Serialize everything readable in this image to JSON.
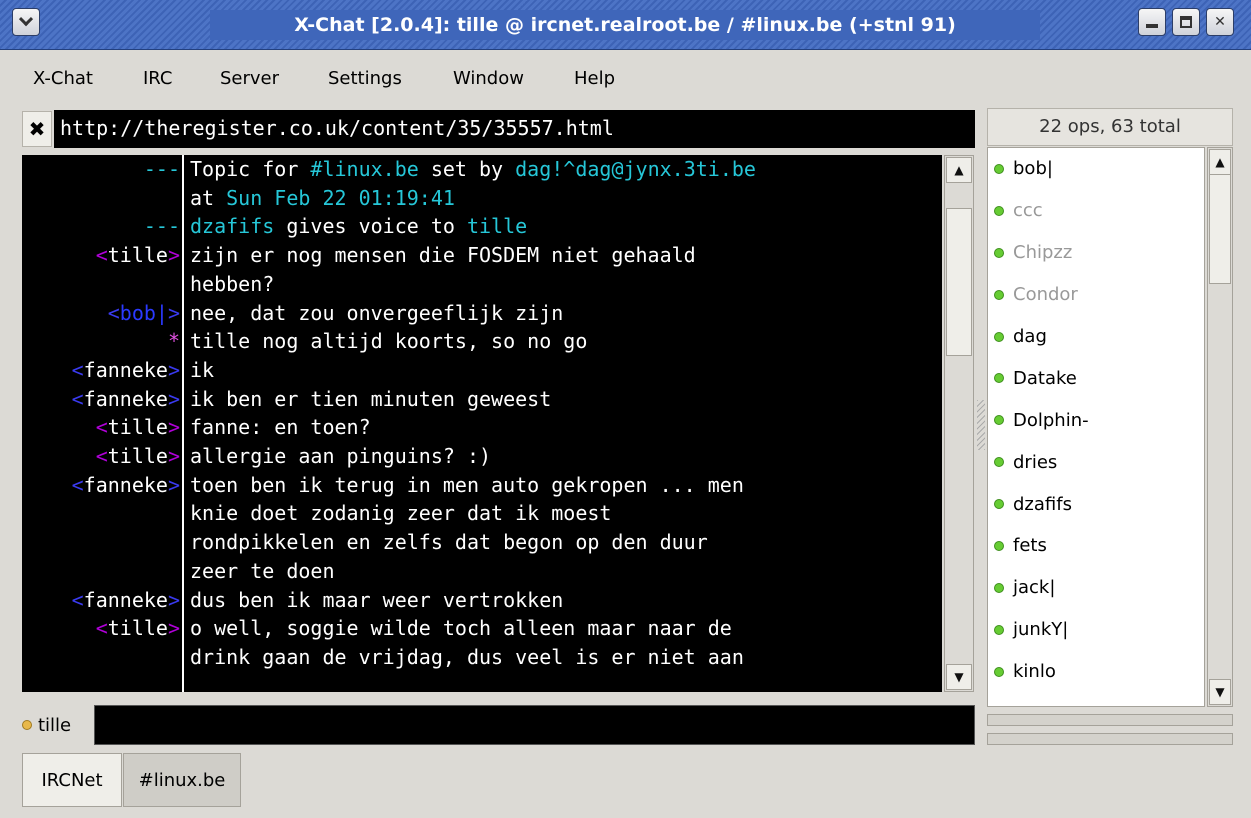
{
  "window": {
    "title": "X-Chat [2.0.4]: tille @ ircnet.realroot.be / #linux.be (+stnl 91)",
    "icons": [
      "window-menu-icon",
      "minimize-icon",
      "maximize-icon",
      "close-icon"
    ]
  },
  "menu": [
    "X-Chat",
    "IRC",
    "Server",
    "Settings",
    "Window",
    "Help"
  ],
  "topic": {
    "close_glyph": "✖",
    "text": "http://theregister.co.uk/content/35/35557.html"
  },
  "user_count": "22 ops, 63 total",
  "chat": [
    {
      "nick": "---",
      "text": "Topic for #linux.be set by dag!^dag@jynx.3ti.be"
    },
    {
      "nick": "",
      "text": "at Sun Feb 22 01:19:41"
    },
    {
      "nick": "---",
      "text": "dzafifs gives voice to tille"
    },
    {
      "nick": "tille",
      "text": "zijn er nog mensen die FOSDEM niet gehaald"
    },
    {
      "nick": "",
      "text": "hebben?"
    },
    {
      "nick": "bob|",
      "text": "nee, dat zou onvergeeflijk zijn"
    },
    {
      "nick": "*",
      "text": "tille nog altijd koorts, so no go"
    },
    {
      "nick": "fanneke",
      "text": "ik"
    },
    {
      "nick": "fanneke",
      "text": "ik ben er tien minuten geweest"
    },
    {
      "nick": "tille",
      "text": "fanne: en toen?"
    },
    {
      "nick": "tille",
      "text": "allergie aan pinguins? :)"
    },
    {
      "nick": "fanneke",
      "text": "toen ben ik terug in men auto gekropen ... men"
    },
    {
      "nick": "",
      "text": "knie doet zodanig zeer dat ik moest"
    },
    {
      "nick": "",
      "text": "rondpikkelen en zelfs dat begon op den duur"
    },
    {
      "nick": "",
      "text": "zeer te doen"
    },
    {
      "nick": "fanneke",
      "text": "dus ben ik maar weer vertrokken"
    },
    {
      "nick": "tille",
      "text": "o well, soggie wilde toch alleen maar naar de"
    },
    {
      "nick": "",
      "text": "drink gaan de vrijdag, dus veel is er niet aan"
    }
  ],
  "users": [
    {
      "name": "bob|",
      "away": false
    },
    {
      "name": "ccc",
      "away": true
    },
    {
      "name": "Chipzz",
      "away": true
    },
    {
      "name": "Condor",
      "away": true
    },
    {
      "name": "dag",
      "away": false
    },
    {
      "name": "Datake",
      "away": false
    },
    {
      "name": "Dolphin-",
      "away": false
    },
    {
      "name": "dries",
      "away": false
    },
    {
      "name": "dzafifs",
      "away": false
    },
    {
      "name": "fets",
      "away": false
    },
    {
      "name": "jack|",
      "away": false
    },
    {
      "name": "junkY|",
      "away": false
    },
    {
      "name": "kinlo",
      "away": false
    }
  ],
  "input": {
    "nick": "tille",
    "value": ""
  },
  "tabs": [
    {
      "label": "IRCNet",
      "active": false
    },
    {
      "label": "#linux.be",
      "active": true
    }
  ],
  "colors": {
    "chat_bg": "#000000",
    "title_bar": "#3f66ba",
    "op_dot": "#66cc33",
    "nick_dot": "#e8b84a"
  }
}
